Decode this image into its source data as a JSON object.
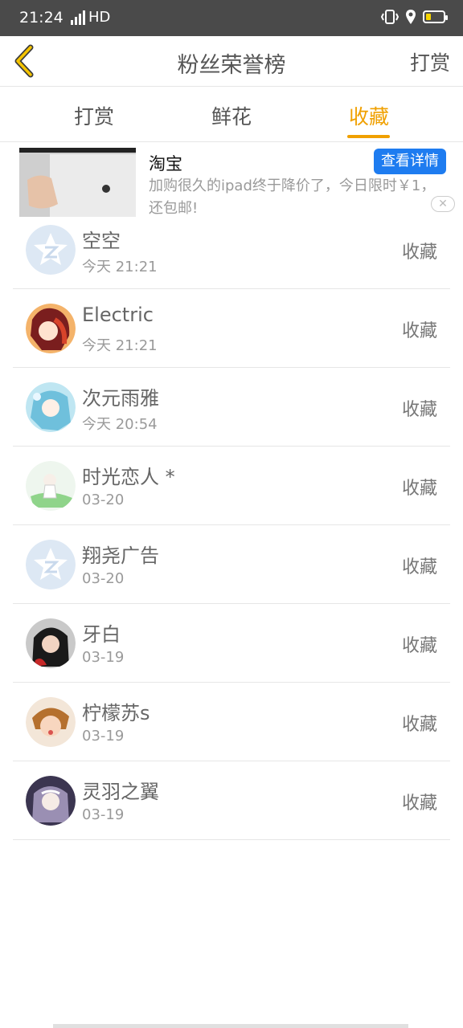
{
  "status": {
    "time": "21:24",
    "network": "4G",
    "hd": "HD"
  },
  "header": {
    "title": "粉丝荣誉榜",
    "right_action": "打赏"
  },
  "tabs": [
    {
      "label": "打赏"
    },
    {
      "label": "鲜花"
    },
    {
      "label": "收藏",
      "active": true
    }
  ],
  "ad": {
    "title": "淘宝",
    "description": "加购很久的ipad终于降价了，今日限时￥1，还包邮!",
    "button": "查看详情",
    "close": "✕"
  },
  "list": [
    {
      "name": "空空",
      "time": "今天 21:21",
      "action": "收藏",
      "avatar": "default-star"
    },
    {
      "name": "Electric",
      "time": "今天 21:21",
      "action": "收藏",
      "avatar": "anime-red"
    },
    {
      "name": "次元雨雅",
      "time": "今天 20:54",
      "action": "收藏",
      "avatar": "anime-blue"
    },
    {
      "name": "时光恋人 *",
      "time": "03-20",
      "action": "收藏",
      "avatar": "anime-green"
    },
    {
      "name": "翔尧广告",
      "time": "03-20",
      "action": "收藏",
      "avatar": "default-star"
    },
    {
      "name": "牙白",
      "time": "03-19",
      "action": "收藏",
      "avatar": "photo-girl"
    },
    {
      "name": "柠檬苏s",
      "time": "03-19",
      "action": "收藏",
      "avatar": "photo-kid"
    },
    {
      "name": "灵羽之翼",
      "time": "03-19",
      "action": "收藏",
      "avatar": "anime-purple"
    }
  ],
  "colors": {
    "accent": "#f0a000",
    "ad_button": "#1e7cf0",
    "status_bar": "#4a4a4a"
  }
}
